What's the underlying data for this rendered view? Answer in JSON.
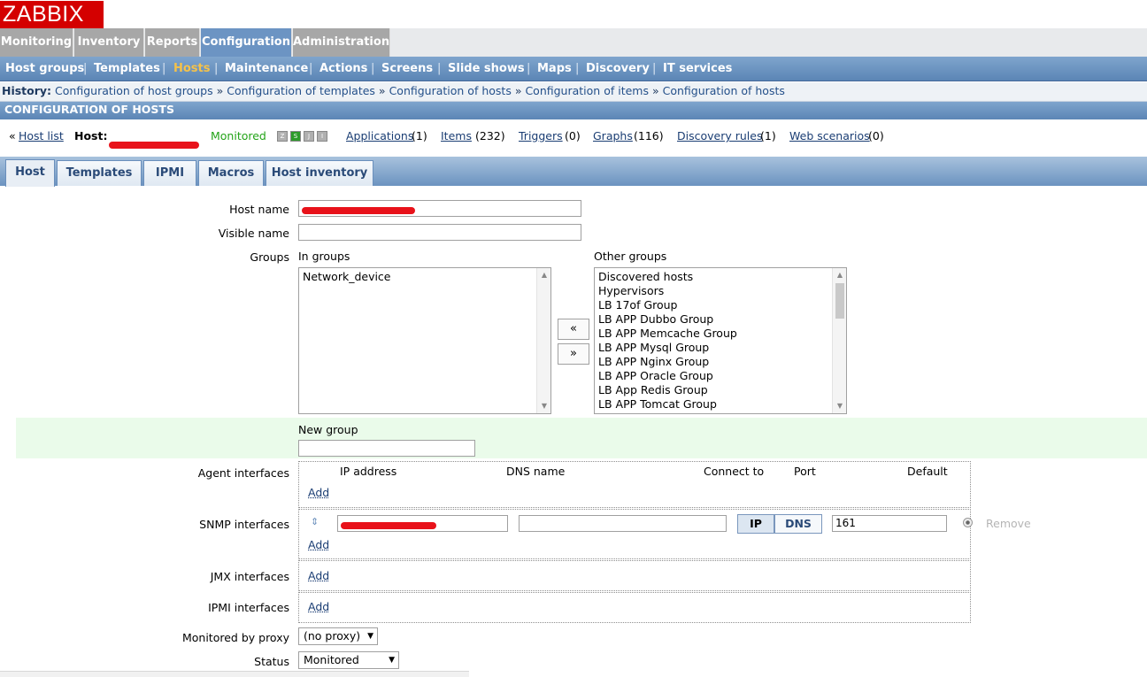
{
  "logo": "ZABBIX",
  "main_menu": [
    "Monitoring",
    "Inventory",
    "Reports",
    "Configuration",
    "Administration"
  ],
  "sub_menu": [
    "Host groups",
    "Templates",
    "Hosts",
    "Maintenance",
    "Actions",
    "Screens",
    "Slide shows",
    "Maps",
    "Discovery",
    "IT services"
  ],
  "history": {
    "label": "History:",
    "items": [
      "Configuration of host groups",
      "Configuration of templates",
      "Configuration of hosts",
      "Configuration of items",
      "Configuration of hosts"
    ],
    "sep": "»"
  },
  "page_title": "CONFIGURATION OF HOSTS",
  "host_line": {
    "host_list_prefix": "«",
    "host_list": "Host list",
    "host_label": "Host:",
    "status": "Monitored",
    "status_icons": [
      "Z",
      "SNMP",
      "JMX",
      "IPMI"
    ],
    "links": [
      {
        "label": "Applications",
        "count": "(1)"
      },
      {
        "label": "Items",
        "count": "(232)"
      },
      {
        "label": "Triggers",
        "count": "(0)"
      },
      {
        "label": "Graphs",
        "count": "(116)"
      },
      {
        "label": "Discovery rules",
        "count": "(1)"
      },
      {
        "label": "Web scenarios",
        "count": "(0)"
      }
    ]
  },
  "tabs": [
    "Host",
    "Templates",
    "IPMI",
    "Macros",
    "Host inventory"
  ],
  "form": {
    "host_name_label": "Host name",
    "visible_name_label": "Visible name",
    "groups_label": "Groups",
    "in_groups_label": "In groups",
    "other_groups_label": "Other groups",
    "in_groups": [
      "Network_device"
    ],
    "other_groups": [
      "Discovered hosts",
      "Hypervisors",
      "LB 17of Group",
      "LB APP Dubbo Group",
      "LB APP Memcache Group",
      "LB APP Mysql Group",
      "LB APP Nginx Group",
      "LB APP Oracle Group",
      "LB App Redis Group",
      "LB APP Tomcat Group"
    ],
    "move_left": "«",
    "move_right": "»",
    "new_group_label": "New group",
    "agent_interfaces_label": "Agent interfaces",
    "iface_headers": {
      "ip": "IP address",
      "dns": "DNS name",
      "connect": "Connect to",
      "port": "Port",
      "default": "Default"
    },
    "add": "Add",
    "snmp_interfaces_label": "SNMP interfaces",
    "snmp": {
      "ip_btn": "IP",
      "dns_btn": "DNS",
      "port": "161",
      "remove": "Remove"
    },
    "jmx_interfaces_label": "JMX interfaces",
    "ipmi_interfaces_label": "IPMI interfaces",
    "proxy_label": "Monitored by proxy",
    "proxy_value": "(no proxy)",
    "status_label": "Status",
    "status_value": "Monitored"
  }
}
